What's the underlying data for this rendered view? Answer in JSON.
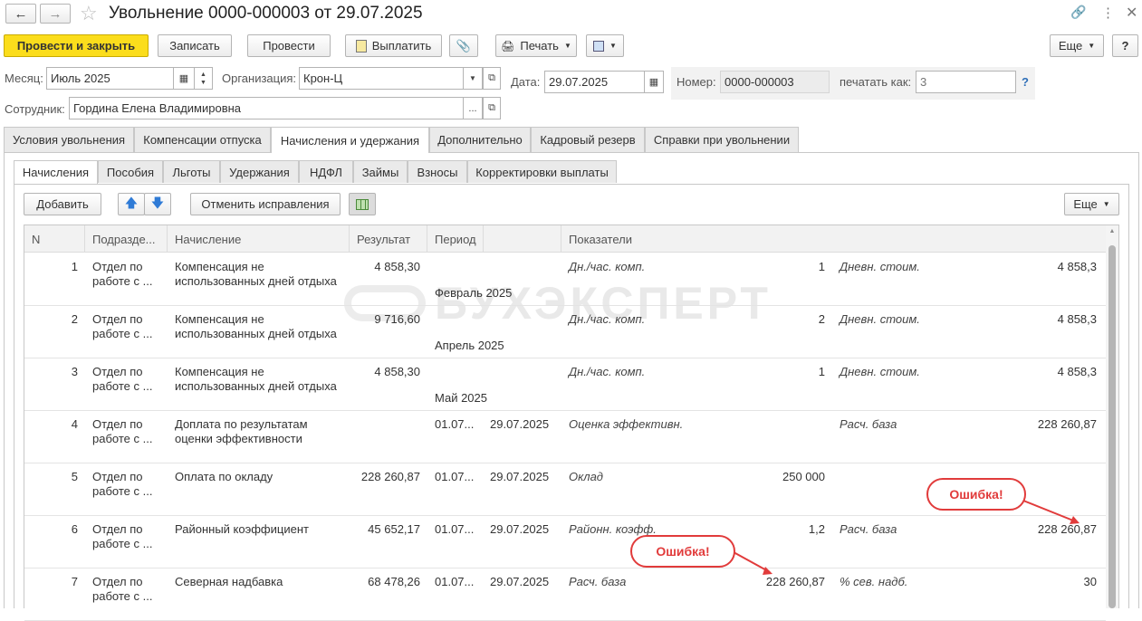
{
  "window": {
    "title": "Увольнение 0000-000003 от 29.07.2025"
  },
  "toolbar": {
    "post_close": "Провести и закрыть",
    "save": "Записать",
    "post": "Провести",
    "pay": "Выплатить",
    "print": "Печать",
    "more": "Еще",
    "help": "?"
  },
  "form": {
    "month_label": "Месяц:",
    "month_value": "Июль 2025",
    "org_label": "Организация:",
    "org_value": "Крон-Ц",
    "date_label": "Дата:",
    "date_value": "29.07.2025",
    "number_label": "Номер:",
    "number_value": "0000-000003",
    "print_as_label": "печатать как:",
    "print_as_placeholder": "3",
    "help_link": "?",
    "employee_label": "Сотрудник:",
    "employee_value": "Гордина Елена Владимировна"
  },
  "tabs": [
    "Условия увольнения",
    "Компенсации отпуска",
    "Начисления и удержания",
    "Дополнительно",
    "Кадровый резерв",
    "Справки при увольнении"
  ],
  "subtabs": [
    "Начисления",
    "Пособия",
    "Льготы",
    "Удержания",
    "НДФЛ",
    "Займы",
    "Взносы",
    "Корректировки выплаты"
  ],
  "table_toolbar": {
    "add": "Добавить",
    "cancel_corrections": "Отменить исправления",
    "more": "Еще"
  },
  "table": {
    "headers": [
      "N",
      "Подразде...",
      "Начисление",
      "Результат",
      "Период",
      "",
      "Показатели"
    ],
    "rows": [
      {
        "n": "1",
        "dept": [
          "Отдел по",
          "работе с ..."
        ],
        "accrual": [
          "Компенсация не",
          "использованных дней отдыха"
        ],
        "result": "4 858,30",
        "period_from": "",
        "period_to": "",
        "period_month": "Февраль 2025",
        "ind1_name": "Дн./час. комп.",
        "ind1_val": "1",
        "ind2_name": "Дневн. стоим.",
        "ind2_val": "4 858,3"
      },
      {
        "n": "2",
        "dept": [
          "Отдел по",
          "работе с ..."
        ],
        "accrual": [
          "Компенсация не",
          "использованных дней отдыха"
        ],
        "result": "9 716,60",
        "period_from": "",
        "period_to": "",
        "period_month": "Апрель 2025",
        "ind1_name": "Дн./час. комп.",
        "ind1_val": "2",
        "ind2_name": "Дневн. стоим.",
        "ind2_val": "4 858,3"
      },
      {
        "n": "3",
        "dept": [
          "Отдел по",
          "работе с ..."
        ],
        "accrual": [
          "Компенсация не",
          "использованных дней отдыха"
        ],
        "result": "4 858,30",
        "period_from": "",
        "period_to": "",
        "period_month": "Май 2025",
        "ind1_name": "Дн./час. комп.",
        "ind1_val": "1",
        "ind2_name": "Дневн. стоим.",
        "ind2_val": "4 858,3"
      },
      {
        "n": "4",
        "dept": [
          "Отдел по",
          "работе с ..."
        ],
        "accrual": [
          "Доплата по результатам",
          "оценки эффективности"
        ],
        "result": "",
        "period_from": "01.07...",
        "period_to": "29.07.2025",
        "period_month": "",
        "ind1_name": "Оценка эффективн.",
        "ind1_val": "",
        "ind2_name": "Расч. база",
        "ind2_val": "228 260,87"
      },
      {
        "n": "5",
        "dept": [
          "Отдел по",
          "работе с ..."
        ],
        "accrual": [
          "Оплата по окладу",
          ""
        ],
        "result": "228 260,87",
        "period_from": "01.07...",
        "period_to": "29.07.2025",
        "period_month": "",
        "ind1_name": "Оклад",
        "ind1_val": "250 000",
        "ind2_name": "",
        "ind2_val": ""
      },
      {
        "n": "6",
        "dept": [
          "Отдел по",
          "работе с ..."
        ],
        "accrual": [
          "Районный коэффициент",
          ""
        ],
        "result": "45 652,17",
        "period_from": "01.07...",
        "period_to": "29.07.2025",
        "period_month": "",
        "ind1_name": "Районн. коэфф.",
        "ind1_val": "1,2",
        "ind2_name": "Расч. база",
        "ind2_val": "228 260,87"
      },
      {
        "n": "7",
        "dept": [
          "Отдел по",
          "работе с ..."
        ],
        "accrual": [
          "Северная надбавка",
          ""
        ],
        "result": "68 478,26",
        "period_from": "01.07...",
        "period_to": "29.07.2025",
        "period_month": "",
        "ind1_name": "Расч. база",
        "ind1_val": "228 260,87",
        "ind2_name": "% сев. надб.",
        "ind2_val": "30"
      }
    ]
  },
  "watermark": "БУХЭКСПЕРТ",
  "callouts": [
    "Ошибка!",
    "Ошибка!"
  ],
  "colors": {
    "accent_button": "#fbdd1c",
    "callout_red": "#e13b3b"
  }
}
